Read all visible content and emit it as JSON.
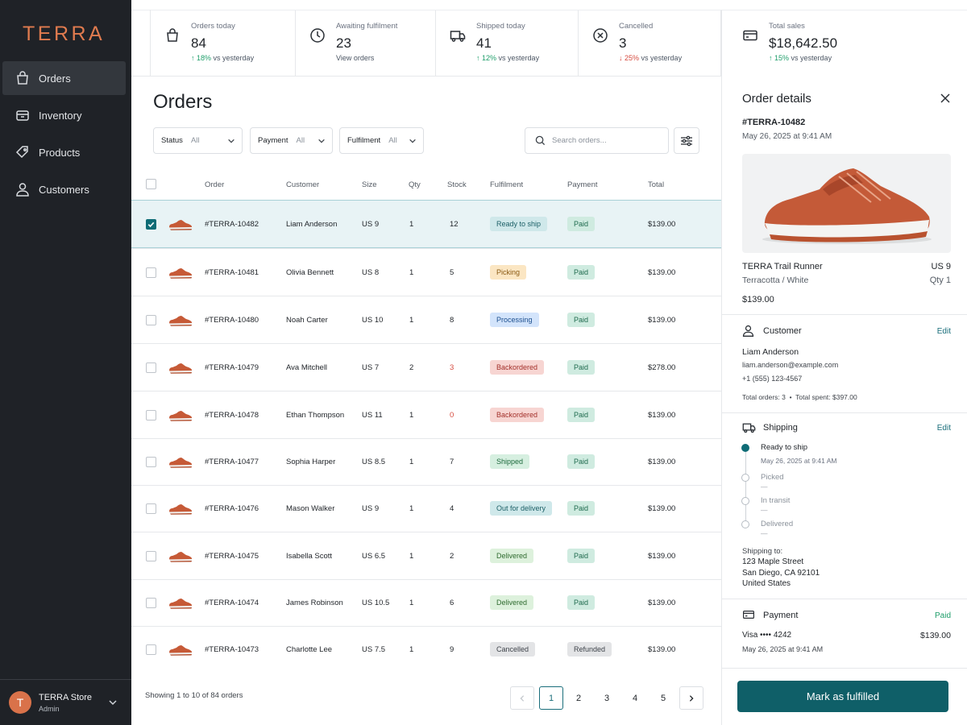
{
  "brand": {
    "logo": "TERRA"
  },
  "sidebar": {
    "items": [
      {
        "label": "Orders",
        "icon": "bag-icon",
        "active": true
      },
      {
        "label": "Inventory",
        "icon": "inventory-icon",
        "active": false
      },
      {
        "label": "Products",
        "icon": "tag-icon",
        "active": false
      },
      {
        "label": "Customers",
        "icon": "user-icon",
        "active": false
      }
    ],
    "store": {
      "initial": "T",
      "name": "TERRA Store",
      "role": "Admin"
    }
  },
  "stats": [
    {
      "label": "Orders today",
      "value": "84",
      "arrow": "↑",
      "change": "18%",
      "suffix": "vs yesterday",
      "trend": "up",
      "icon": "bag-icon"
    },
    {
      "label": "Awaiting fulfilment",
      "value": "23",
      "link": "View orders",
      "icon": "clock-icon"
    },
    {
      "label": "Shipped today",
      "value": "41",
      "arrow": "↑",
      "change": "12%",
      "suffix": "vs yesterday",
      "trend": "up",
      "icon": "truck-icon"
    },
    {
      "label": "Cancelled",
      "value": "3",
      "arrow": "↓",
      "change": "25%",
      "suffix": "vs yesterday",
      "trend": "down",
      "icon": "x-circle-icon"
    },
    {
      "label": "Total sales",
      "value": "$18,642.50",
      "arrow": "↑",
      "change": "15%",
      "suffix": "vs yesterday",
      "trend": "up",
      "icon": "card-icon"
    }
  ],
  "main": {
    "title": "Orders",
    "filters": [
      {
        "label": "Status",
        "value": "All"
      },
      {
        "label": "Payment",
        "value": "All"
      },
      {
        "label": "Fulfilment",
        "value": "All"
      }
    ],
    "search_placeholder": "Search orders...",
    "columns": [
      "Order",
      "Customer",
      "Size",
      "Qty",
      "Stock",
      "Fulfilment",
      "Payment",
      "Total"
    ],
    "rows": [
      {
        "order": "#TERRA-10482",
        "customer": "Liam Anderson",
        "size": "US 9",
        "qty": "1",
        "stock": "12",
        "low_stock": false,
        "fulfilment": "Ready to ship",
        "fclass": "b-ready",
        "payment": "Paid",
        "pclass": "b-paid",
        "total": "$139.00",
        "selected": true
      },
      {
        "order": "#TERRA-10481",
        "customer": "Olivia Bennett",
        "size": "US 8",
        "qty": "1",
        "stock": "5",
        "low_stock": false,
        "fulfilment": "Picking",
        "fclass": "b-pick",
        "payment": "Paid",
        "pclass": "b-paid",
        "total": "$139.00",
        "selected": false
      },
      {
        "order": "#TERRA-10480",
        "customer": "Noah Carter",
        "size": "US 10",
        "qty": "1",
        "stock": "8",
        "low_stock": false,
        "fulfilment": "Processing",
        "fclass": "b-proc",
        "payment": "Paid",
        "pclass": "b-paid",
        "total": "$139.00",
        "selected": false
      },
      {
        "order": "#TERRA-10479",
        "customer": "Ava Mitchell",
        "size": "US 7",
        "qty": "2",
        "stock": "3",
        "low_stock": true,
        "fulfilment": "Backordered",
        "fclass": "b-back",
        "payment": "Paid",
        "pclass": "b-paid",
        "total": "$278.00",
        "selected": false
      },
      {
        "order": "#TERRA-10478",
        "customer": "Ethan Thompson",
        "size": "US 11",
        "qty": "1",
        "stock": "0",
        "low_stock": true,
        "fulfilment": "Backordered",
        "fclass": "b-back",
        "payment": "Paid",
        "pclass": "b-paid",
        "total": "$139.00",
        "selected": false
      },
      {
        "order": "#TERRA-10477",
        "customer": "Sophia Harper",
        "size": "US 8.5",
        "qty": "1",
        "stock": "7",
        "low_stock": false,
        "fulfilment": "Shipped",
        "fclass": "b-ship",
        "payment": "Paid",
        "pclass": "b-paid",
        "total": "$139.00",
        "selected": false
      },
      {
        "order": "#TERRA-10476",
        "customer": "Mason Walker",
        "size": "US 9",
        "qty": "1",
        "stock": "4",
        "low_stock": false,
        "fulfilment": "Out for delivery",
        "fclass": "b-out",
        "payment": "Paid",
        "pclass": "b-paid",
        "total": "$139.00",
        "selected": false
      },
      {
        "order": "#TERRA-10475",
        "customer": "Isabella Scott",
        "size": "US 6.5",
        "qty": "1",
        "stock": "2",
        "low_stock": false,
        "fulfilment": "Delivered",
        "fclass": "b-deliv",
        "payment": "Paid",
        "pclass": "b-paid",
        "total": "$139.00",
        "selected": false
      },
      {
        "order": "#TERRA-10474",
        "customer": "James Robinson",
        "size": "US 10.5",
        "qty": "1",
        "stock": "6",
        "low_stock": false,
        "fulfilment": "Delivered",
        "fclass": "b-deliv",
        "payment": "Paid",
        "pclass": "b-paid",
        "total": "$139.00",
        "selected": false
      },
      {
        "order": "#TERRA-10473",
        "customer": "Charlotte Lee",
        "size": "US 7.5",
        "qty": "1",
        "stock": "9",
        "low_stock": false,
        "fulfilment": "Cancelled",
        "fclass": "b-canc",
        "payment": "Refunded",
        "pclass": "b-ref",
        "total": "$139.00",
        "selected": false
      }
    ],
    "showing": "Showing 1 to 10 of 84 orders",
    "pages": [
      "1",
      "2",
      "3",
      "4",
      "5"
    ],
    "current_page": "1"
  },
  "panel": {
    "title": "Order details",
    "order_id": "#TERRA-10482",
    "date": "May 26, 2025 at 9:41 AM",
    "product": {
      "name": "TERRA Trail Runner",
      "color": "Terracotta / White",
      "size": "US 9",
      "qty": "Qty 1",
      "price": "$139.00"
    },
    "customer": {
      "heading": "Customer",
      "edit": "Edit",
      "name": "Liam Anderson",
      "email": "liam.anderson@example.com",
      "phone": "+1 (555) 123-4567",
      "orders": "Total orders: 3",
      "bullet": "•",
      "spent": "Total spent: $397.00"
    },
    "shipping": {
      "heading": "Shipping",
      "edit": "Edit",
      "steps": [
        {
          "label": "Ready to ship",
          "sub": "May 26, 2025 at 9:41 AM",
          "done": true
        },
        {
          "label": "Picked",
          "sub": "—",
          "done": false
        },
        {
          "label": "In transit",
          "sub": "—",
          "done": false
        },
        {
          "label": "Delivered",
          "sub": "—",
          "done": false
        }
      ],
      "to_label": "Shipping to:",
      "address": [
        "123 Maple Street",
        "San Diego, CA 92101",
        "United States"
      ]
    },
    "payment": {
      "heading": "Payment",
      "status": "Paid",
      "card": "Visa •••• 4242",
      "amount": "$139.00",
      "date": "May 26, 2025 at 9:41 AM"
    },
    "cta": "Mark as fulfilled"
  },
  "colors": {
    "accent": "#0f5f68",
    "brand": "#e07b4f",
    "sidebar": "#1f2227",
    "up": "#1e9e6a",
    "down": "#d64b3f"
  }
}
